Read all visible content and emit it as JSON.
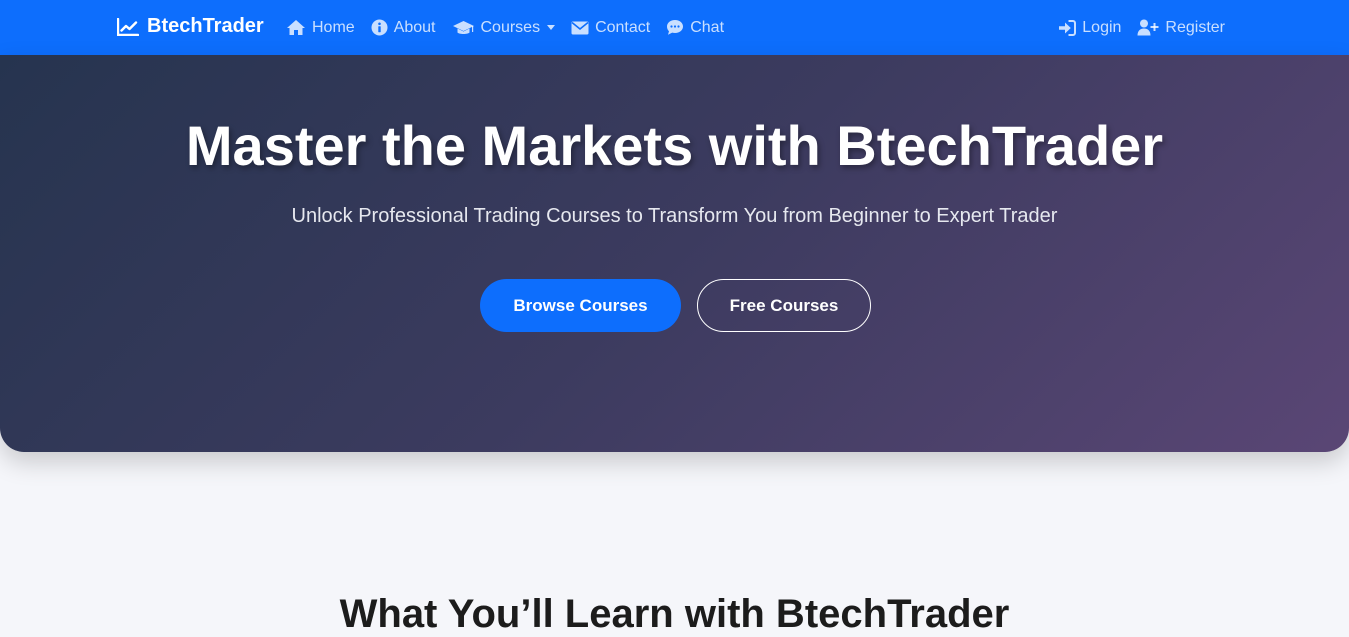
{
  "navbar": {
    "brand": {
      "label": "BtechTrader",
      "icon": "chart-line-icon"
    },
    "left_links": [
      {
        "label": "Home",
        "icon": "home-icon"
      },
      {
        "label": "About",
        "icon": "info-circle-icon"
      },
      {
        "label": "Courses",
        "icon": "graduation-cap-icon",
        "dropdown": true
      },
      {
        "label": "Contact",
        "icon": "envelope-icon"
      },
      {
        "label": "Chat",
        "icon": "chat-bubble-icon"
      }
    ],
    "right_links": [
      {
        "label": "Login",
        "icon": "sign-in-icon"
      },
      {
        "label": "Register",
        "icon": "user-plus-icon"
      }
    ]
  },
  "hero": {
    "title": "Master the Markets with BtechTrader",
    "subtitle": "Unlock Professional Trading Courses to Transform You from Beginner to Expert Trader",
    "primary_button": "Browse Courses",
    "secondary_button": "Free Courses"
  },
  "learn_section": {
    "title": "What You’ll Learn with BtechTrader"
  },
  "colors": {
    "navbar": "#0d6efd",
    "primary": "#0d6efd",
    "hero_gradient_start": "#26344f",
    "hero_gradient_end": "#5a4675",
    "page_background": "#f5f6fa"
  }
}
